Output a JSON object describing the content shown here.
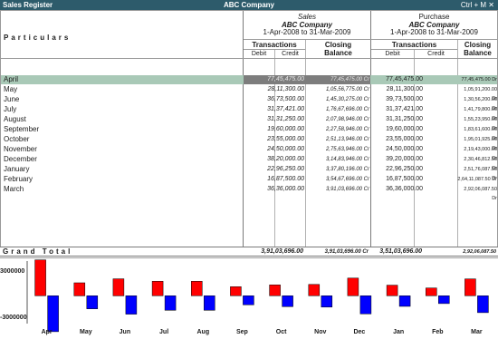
{
  "window": {
    "title": "Sales Register",
    "company": "ABC Company",
    "shortcut": "Ctrl + M",
    "close_glyph": "✕"
  },
  "headers": {
    "particulars": "Particulars",
    "sales": {
      "label": "Sales",
      "company": "ABC Company",
      "period": "1-Apr-2008 to 31-Mar-2009"
    },
    "purchase": {
      "label": "Purchase",
      "company": "ABC Company",
      "period": "1-Apr-2008 to 31-Mar-2009"
    },
    "transactions": "Transactions",
    "closing": "Closing",
    "balance": "Balance",
    "debit": "Debit",
    "credit": "Credit"
  },
  "rows": [
    {
      "month": "April",
      "sales_debit": "77,45,475.00",
      "sales_closing": "77,45,475.00 Cr",
      "purchase_debit": "77,45,475.00",
      "purchase_closing": "77,45,475.00 Dr",
      "selected": true
    },
    {
      "month": "May",
      "sales_debit": "28,11,300.00",
      "sales_closing": "1,05,56,775.00 Cr",
      "purchase_debit": "28,11,300.00",
      "purchase_closing": "1,05,91,200.00 Dr"
    },
    {
      "month": "June",
      "sales_debit": "36,73,500.00",
      "sales_closing": "1,45,30,275.00 Cr",
      "purchase_debit": "39,73,500.00",
      "purchase_closing": "1,30,56,200.00 Dr"
    },
    {
      "month": "July",
      "sales_debit": "31,37,421.00",
      "sales_closing": "1,76,67,696.00 Cr",
      "purchase_debit": "31,37,421.00",
      "purchase_closing": "1,41,79,800.00 Dr"
    },
    {
      "month": "August",
      "sales_debit": "31,31,250.00",
      "sales_closing": "2,07,98,946.00 Cr",
      "purchase_debit": "31,31,250.00",
      "purchase_closing": "1,55,23,950.00 Dr"
    },
    {
      "month": "September",
      "sales_debit": "19,60,000.00",
      "sales_closing": "2,27,58,946.00 Cr",
      "purchase_debit": "19,60,000.00",
      "purchase_closing": "1,83,61,600.00 Dr"
    },
    {
      "month": "October",
      "sales_debit": "23,55,000.00",
      "sales_closing": "2,51,13,946.00 Cr",
      "purchase_debit": "23,55,000.00",
      "purchase_closing": "1,95,01,925.00 Dr"
    },
    {
      "month": "November",
      "sales_debit": "24,50,000.00",
      "sales_closing": "2,75,63,946.00 Cr",
      "purchase_debit": "24,50,000.00",
      "purchase_closing": "2,19,43,000.00 Dr"
    },
    {
      "month": "December",
      "sales_debit": "38,20,000.00",
      "sales_closing": "3,14,83,946.00 Cr",
      "purchase_debit": "39,20,000.00",
      "purchase_closing": "2,30,46,812.50 Dr"
    },
    {
      "month": "January",
      "sales_debit": "22,96,250.00",
      "sales_closing": "3,37,80,196.00 Cr",
      "purchase_debit": "22,96,250.00",
      "purchase_closing": "2,51,76,087.50 Dr"
    },
    {
      "month": "February",
      "sales_debit": "16,87,500.00",
      "sales_closing": "3,54,67,696.00 Cr",
      "purchase_debit": "16,87,500.00",
      "purchase_closing": "2,64,11,087.50 Dr"
    },
    {
      "month": "March",
      "sales_debit": "36,36,000.00",
      "sales_closing": "3,91,03,696.00 Cr",
      "purchase_debit": "36,36,000.00",
      "purchase_closing": "2,92,06,087.50 Dr"
    }
  ],
  "grand_total": {
    "label": "Grand Total",
    "sales_debit": "3,91,03,696.00",
    "sales_closing": "3,91,03,696.00 Cr",
    "purchase_debit": "3,51,03,696.00",
    "purchase_closing": "2,92,06,087.50 Dr"
  },
  "chart_data": {
    "type": "bar",
    "categories": [
      "Apr",
      "May",
      "Jun",
      "Jul",
      "Aug",
      "Sep",
      "Oct",
      "Nov",
      "Dec",
      "Jan",
      "Feb",
      "Mar"
    ],
    "ytick_labels": [
      "3000000",
      "-3000000"
    ],
    "ylim": [
      -6000000,
      7500000
    ],
    "series": [
      {
        "values": [
          7745475,
          2811300,
          3673500,
          3137421,
          3131250,
          1960000,
          2355000,
          2450000,
          3820000,
          2296250,
          1687500,
          3636000
        ],
        "color": "#ff0000"
      },
      {
        "values": [
          -7745475,
          -2811300,
          -3973500,
          -3137421,
          -3131250,
          -1960000,
          -2355000,
          -2450000,
          -3920000,
          -2296250,
          -1687500,
          -3636000
        ],
        "color": "#0000ff"
      }
    ]
  }
}
